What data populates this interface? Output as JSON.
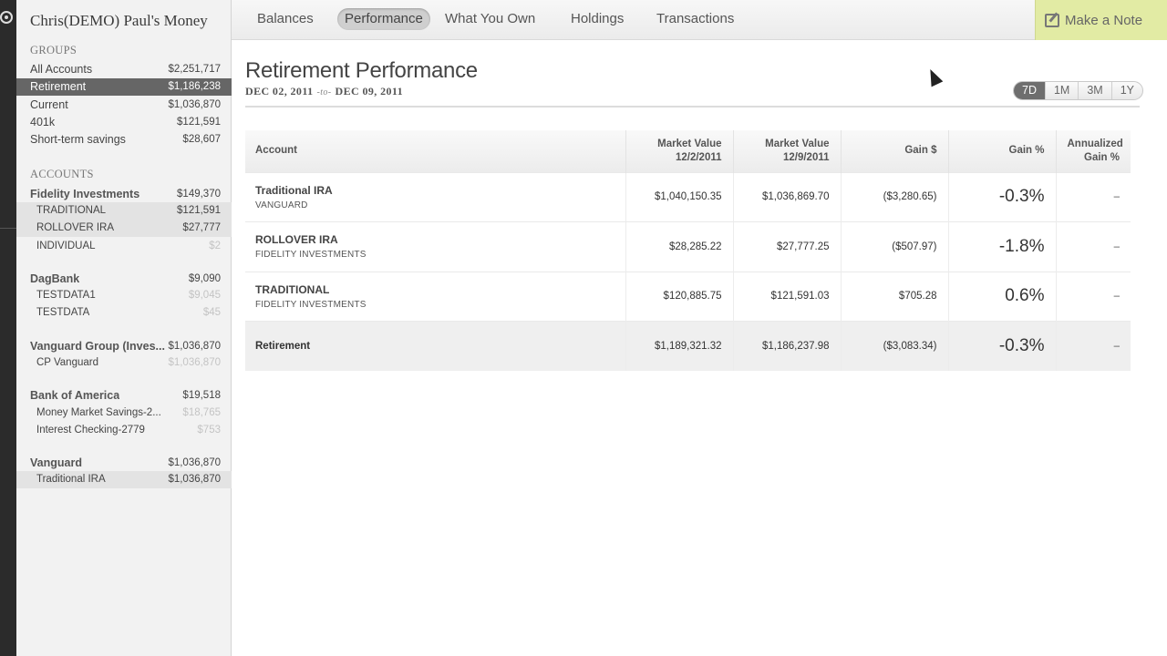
{
  "sidebar": {
    "title": "Chris(DEMO) Paul's Money",
    "groups_header": "GROUPS",
    "groups": [
      {
        "label": "All Accounts",
        "value": "$2,251,717"
      },
      {
        "label": "Retirement",
        "value": "$1,186,238"
      },
      {
        "label": "Current",
        "value": "$1,036,870"
      },
      {
        "label": "401k",
        "value": "$121,591"
      },
      {
        "label": "Short-term savings",
        "value": "$28,607"
      }
    ],
    "accounts_header": "ACCOUNTS",
    "institutions": [
      {
        "name": "Fidelity Investments",
        "value": "$149,370",
        "accounts": [
          {
            "label": "TRADITIONAL",
            "value": "$121,591"
          },
          {
            "label": "ROLLOVER IRA",
            "value": "$27,777"
          },
          {
            "label": "INDIVIDUAL",
            "value": "$2"
          }
        ]
      },
      {
        "name": "DagBank",
        "value": "$9,090",
        "accounts": [
          {
            "label": "TESTDATA1",
            "value": "$9,045"
          },
          {
            "label": "TESTDATA",
            "value": "$45"
          }
        ]
      },
      {
        "name": "Vanguard Group (Inves...",
        "value": "$1,036,870",
        "accounts": [
          {
            "label": "CP Vanguard",
            "value": "$1,036,870"
          }
        ]
      },
      {
        "name": "Bank of America",
        "value": "$19,518",
        "accounts": [
          {
            "label": "Money Market Savings-2...",
            "value": "$18,765"
          },
          {
            "label": "Interest Checking-2779",
            "value": "$753"
          }
        ]
      },
      {
        "name": "Vanguard",
        "value": "$1,036,870",
        "accounts": [
          {
            "label": "Traditional IRA",
            "value": "$1,036,870"
          }
        ]
      }
    ]
  },
  "nav": {
    "tabs": [
      "Balances",
      "Performance",
      "What You Own",
      "Holdings",
      "Transactions"
    ],
    "active_tab": "Performance",
    "note_button": "Make a Note"
  },
  "main": {
    "title": "Retirement Performance",
    "date_from": "DEC 02, 2011",
    "date_sep": "-to-",
    "date_to": "DEC 09, 2011",
    "ranges": [
      "7D",
      "1M",
      "3M",
      "1Y"
    ],
    "active_range": "7D"
  },
  "table": {
    "headers": {
      "account": "Account",
      "mv1_l1": "Market Value",
      "mv1_l2": "12/2/2011",
      "mv2_l1": "Market Value",
      "mv2_l2": "12/9/2011",
      "gain_d": "Gain $",
      "gain_p": "Gain %",
      "ann_l1": "Annualized",
      "ann_l2": "Gain %"
    },
    "rows": [
      {
        "name": "Traditional IRA",
        "inst": "VANGUARD",
        "mv1": "$1,040,150.35",
        "mv2": "$1,036,869.70",
        "gain_d": "($3,280.65)",
        "gain_p": "-0.3%",
        "ann": "–"
      },
      {
        "name": "ROLLOVER IRA",
        "inst": "FIDELITY INVESTMENTS",
        "mv1": "$28,285.22",
        "mv2": "$27,777.25",
        "gain_d": "($507.97)",
        "gain_p": "-1.8%",
        "ann": "–"
      },
      {
        "name": "TRADITIONAL",
        "inst": "FIDELITY INVESTMENTS",
        "mv1": "$120,885.75",
        "mv2": "$121,591.03",
        "gain_d": "$705.28",
        "gain_p": "0.6%",
        "ann": "–"
      }
    ],
    "total": {
      "name": "Retirement",
      "mv1": "$1,189,321.32",
      "mv2": "$1,186,237.98",
      "gain_d": "($3,083.34)",
      "gain_p": "-0.3%",
      "ann": "–"
    }
  },
  "colors": {
    "negative": "#c0273a",
    "positive": "#4c8a2a",
    "note_button": "#e2eba4",
    "selected_row": "#666666"
  }
}
